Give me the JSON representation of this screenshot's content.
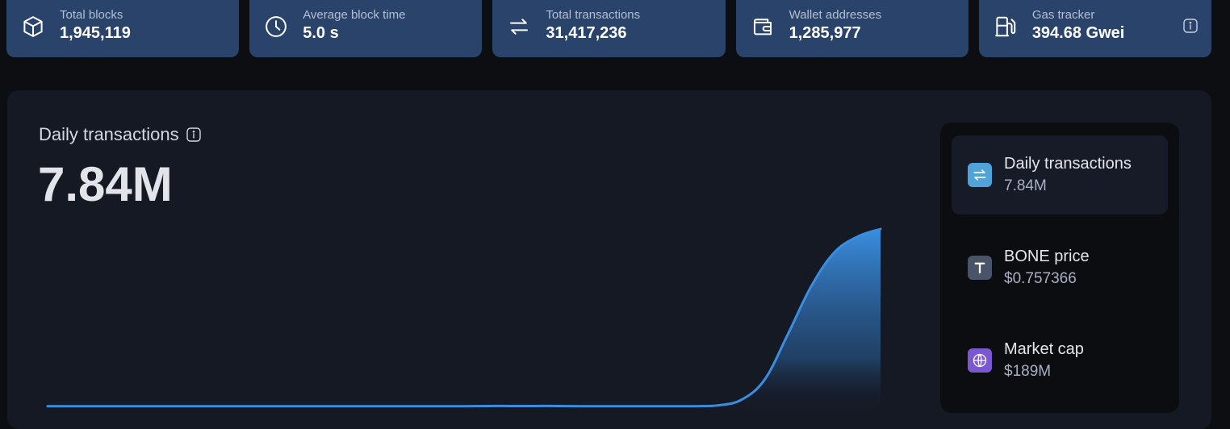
{
  "stats": [
    {
      "label": "Total blocks",
      "value": "1,945,119",
      "icon": "cube-icon"
    },
    {
      "label": "Average block time",
      "value": "5.0 s",
      "icon": "clock-icon"
    },
    {
      "label": "Total transactions",
      "value": "31,417,236",
      "icon": "transfer-arrows-icon"
    },
    {
      "label": "Wallet addresses",
      "value": "1,285,977",
      "icon": "wallet-icon"
    },
    {
      "label": "Gas tracker",
      "value": "394.68 Gwei",
      "icon": "gas-pump-icon"
    }
  ],
  "chart": {
    "title": "Daily transactions",
    "value": "7.84M"
  },
  "side": {
    "items": [
      {
        "name": "Daily transactions",
        "value": "7.84M",
        "icon": "transfer-arrows-icon",
        "color": "#4fa3d9"
      },
      {
        "name": "BONE price",
        "value": "$0.757366",
        "icon": "token-t-icon",
        "color": "#4a5468"
      },
      {
        "name": "Market cap",
        "value": "$189M",
        "icon": "globe-icon",
        "color": "#7b58d1"
      }
    ]
  },
  "chart_data": {
    "type": "area",
    "x": [
      0,
      1,
      2,
      3,
      4,
      5,
      6,
      7,
      8,
      9,
      10,
      11,
      12,
      13,
      14,
      15,
      16,
      17,
      18,
      19,
      20,
      21,
      22,
      23,
      24,
      25,
      26,
      27,
      28,
      29,
      30,
      31,
      32,
      33,
      34,
      35,
      36
    ],
    "values": [
      0.01,
      0.01,
      0.01,
      0.01,
      0.01,
      0.01,
      0.01,
      0.01,
      0.01,
      0.01,
      0.01,
      0.01,
      0.01,
      0.01,
      0.01,
      0.01,
      0.01,
      0.01,
      0.01,
      0.02,
      0.02,
      0.02,
      0.02,
      0.01,
      0.01,
      0.01,
      0.01,
      0.01,
      0.01,
      0.05,
      0.3,
      1.2,
      3.2,
      5.3,
      6.8,
      7.5,
      7.84
    ],
    "ylim": [
      0,
      7.84
    ],
    "grid": false,
    "color": "#3a8ee0"
  }
}
